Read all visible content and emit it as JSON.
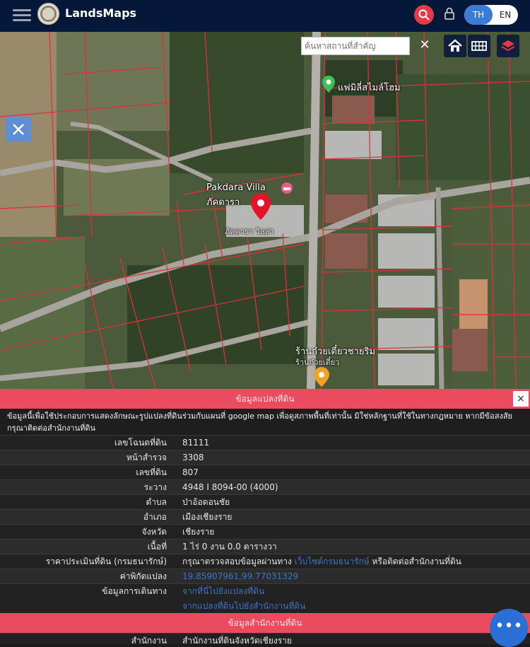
{
  "app": {
    "title": "LandsMaps"
  },
  "header": {
    "lang_th": "TH",
    "lang_en": "EN"
  },
  "map": {
    "search_placeholder": "ค้นหาสถานที่สำคัญ",
    "clear_label": "✕",
    "labels": {
      "family_home": "แฟมิลี่สไมล์โฮม",
      "villa_en": "Pakdara Villa",
      "villa_th": "ภัคดารา",
      "villa_sub": "ภัคดารา วิลล่า",
      "shop": "ร้านก๋วยเตี๋ยวชายริม",
      "shop_sub": "ร้านก๋วยเตี๋ยว"
    }
  },
  "panel": {
    "title": "ข้อมูลแปลงที่ดิน",
    "close_label": "×",
    "disclaimer": "ข้อมูลนี้เพื่อใช้ประกอบการแสดงลักษณะรูปแปลงที่ดินร่วมกับแผนที่ google map เพื่อดูสภาพพื้นที่เท่านั้น มิใช่หลักฐานที่ใช้ในทางกฎหมาย หากมีข้อสงสัย กรุณาติดต่อสำนักงานที่ดิน",
    "rows": [
      {
        "label": "เลขโฉนดที่ดิน",
        "value": "81111"
      },
      {
        "label": "หน้าสำรวจ",
        "value": "3308"
      },
      {
        "label": "เลขที่ดิน",
        "value": "807"
      },
      {
        "label": "ระวาง",
        "value": "4948 I 8094-00 (4000)"
      },
      {
        "label": "ตำบล",
        "value": "ป่าอ้อดอนชัย"
      },
      {
        "label": "อำเภอ",
        "value": "เมืองเชียงราย"
      },
      {
        "label": "จังหวัด",
        "value": "เชียงราย"
      },
      {
        "label": "เนื้อที่",
        "value": "1 ไร่ 0 งาน 0.0 ตารางวา"
      }
    ],
    "price": {
      "label": "ราคาประเมินที่ดิน (กรมธนารักษ์)",
      "prefix": "กรุณาตรวจสอบข้อมูลผ่านทาง",
      "link": "เว็บไซต์กรมธนารักษ์",
      "suffix": "หรือติดต่อสำนักงานที่ดิน"
    },
    "coords": {
      "label": "ค่าพิกัดแปลง",
      "value": "19.85907961,99.77031329"
    },
    "travel": {
      "label": "ข้อมูลการเดินทาง",
      "link1": "จากที่นี่ไปยังแปลงที่ดิน",
      "link2": "จากแปลงที่ดินไปยังสำนักงานที่ดิน"
    },
    "office_title": "ข้อมูลสำนักงานที่ดิน",
    "office": {
      "label": "สำนักงาน",
      "value": "สำนักงานที่ดินจังหวัดเชียงราย"
    }
  },
  "fab": {
    "label": "•••"
  },
  "colors": {
    "topbar": "#06183a",
    "accent_red": "#ea4b5e",
    "link_blue": "#3d74c9",
    "lang_active": "#3a7bd5"
  }
}
